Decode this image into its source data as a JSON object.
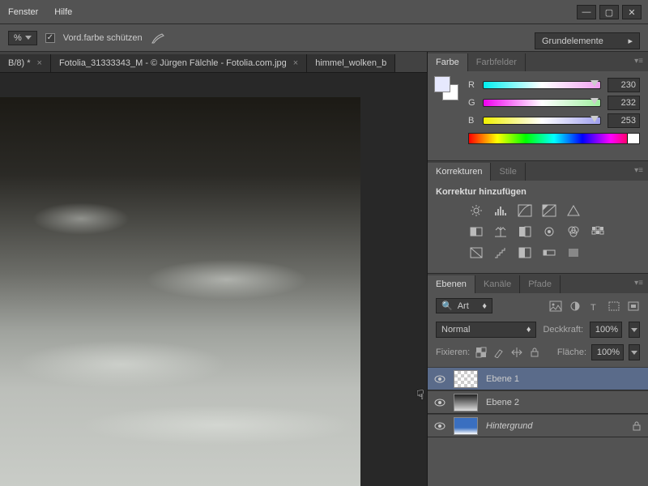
{
  "menu": {
    "fenster": "Fenster",
    "hilfe": "Hilfe"
  },
  "options": {
    "percent_suffix": "%",
    "vordfarbe": "Vord.farbe schützen"
  },
  "workspace": {
    "label": "Grundelemente"
  },
  "doc_tabs": {
    "t1": "B/8) *",
    "t2": "Fotolia_31333343_M - © Jürgen Fälchle - Fotolia.com.jpg",
    "t3": "himmel_wolken_b",
    "more": ">>"
  },
  "panel_farbe": {
    "tab1": "Farbe",
    "tab2": "Farbfelder",
    "r_label": "R",
    "g_label": "G",
    "b_label": "B",
    "r_val": "230",
    "g_val": "232",
    "b_val": "253"
  },
  "panel_korrekturen": {
    "tab1": "Korrekturen",
    "tab2": "Stile",
    "heading": "Korrektur hinzufügen"
  },
  "panel_ebenen": {
    "tab1": "Ebenen",
    "tab2": "Kanäle",
    "tab3": "Pfade",
    "art_label": "Art",
    "blend_mode": "Normal",
    "deckkraft_label": "Deckkraft:",
    "deckkraft_val": "100%",
    "fixieren_label": "Fixieren:",
    "flaeche_label": "Fläche:",
    "flaeche_val": "100%",
    "layers": {
      "l1": "Ebene 1",
      "l2": "Ebene 2",
      "l3": "Hintergrund"
    }
  }
}
